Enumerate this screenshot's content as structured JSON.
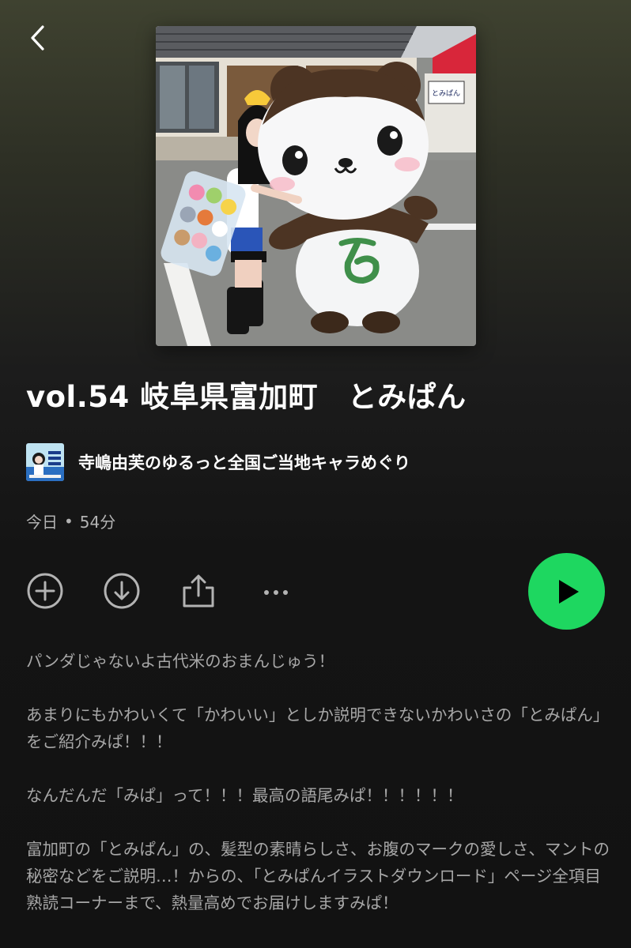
{
  "nav": {
    "back_icon": "chevron-left-icon"
  },
  "cover": {
    "sign_text": "とみぱん",
    "alt": "episode-cover-art"
  },
  "episode": {
    "title": "vol.54 岐阜県富加町　とみぱん",
    "date": "今日",
    "separator": "•",
    "duration": "54分"
  },
  "show": {
    "name": "寺嶋由芙のゆるっと全国ご当地キャラめぐり"
  },
  "actions": {
    "add_icon": "plus-circle-icon",
    "download_icon": "download-circle-icon",
    "share_icon": "share-icon",
    "more_icon": "more-dots-icon",
    "play_icon": "play-icon",
    "play_color": "#1ed760"
  },
  "description": {
    "paragraphs": [
      "パンダじゃないよ古代米のおまんじゅう！",
      "あまりにもかわいくて「かわいい」としか説明できないかわいさの「とみぱん」をご紹介みぱ！！！",
      "なんだんだ「みぱ」って！！！最高の語尾みぱ！！！！！！",
      "富加町の「とみぱん」の、髪型の素晴らしさ、お腹のマークの愛しさ、マントの秘密などをご説明…！からの、「とみぱんイラストダウンロード」ページ全項目熟読コーナーまで、熱量高めでお届けしますみぱ！"
    ]
  }
}
